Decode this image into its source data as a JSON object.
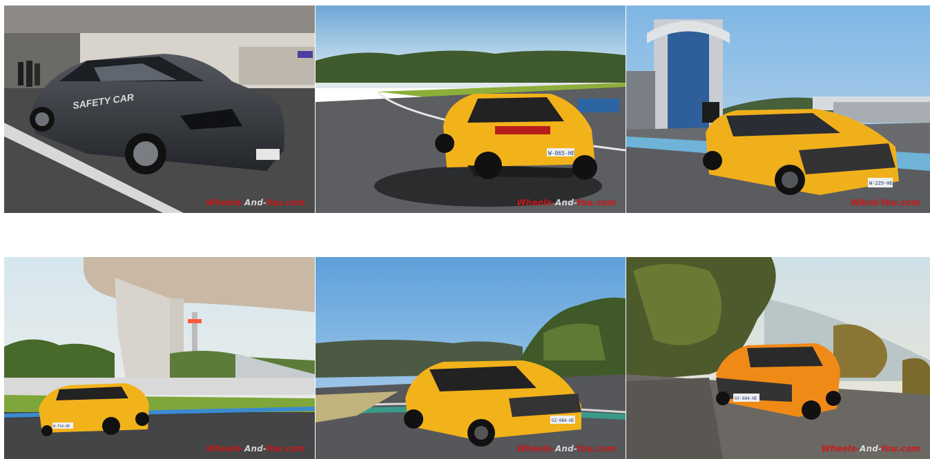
{
  "gallery": {
    "photos": [
      {
        "subject": "dark grey Renault Megane RS safety car in pit lane",
        "car_decal": "SAFETY CAR",
        "watermark": {
          "pre": "Wheels-",
          "mid": "And-",
          "post": "You.com"
        }
      },
      {
        "subject": "yellow Renault Megane RS rear view on track",
        "plate": "W-065-HE",
        "watermark": {
          "pre": "Wheels-",
          "mid": "And-",
          "post": "You.com"
        }
      },
      {
        "subject": "yellow Renault Megane RS front three-quarter by control tower",
        "plate": "W-2Z9-HE",
        "watermark": {
          "pre": "W",
          "mid": "",
          "post": "And-You.com"
        }
      },
      {
        "subject": "yellow Renault Megane RS under circuit canopy",
        "plate": "W-7S4-HE",
        "watermark": {
          "pre": "Wheels-",
          "mid": "And-",
          "post": "You.com"
        }
      },
      {
        "subject": "yellow Renault Megane RS cornering on track",
        "plate": "GZ-0B4-HE",
        "watermark": {
          "pre": "Wheels-",
          "mid": "And-",
          "post": "You.com"
        }
      },
      {
        "subject": "orange Renault Megane RS on hillside road at sunset",
        "plate": "GY-084-HE",
        "watermark": {
          "pre": "Wheels-",
          "mid": "And-",
          "post": "You.com"
        }
      }
    ]
  },
  "colors": {
    "background": "#ffffff",
    "watermark_red": "#d81818",
    "rs_yellow": "#f2b21a",
    "rs_orange": "#f08a17",
    "safety_car_grey": "#3a3d42"
  }
}
